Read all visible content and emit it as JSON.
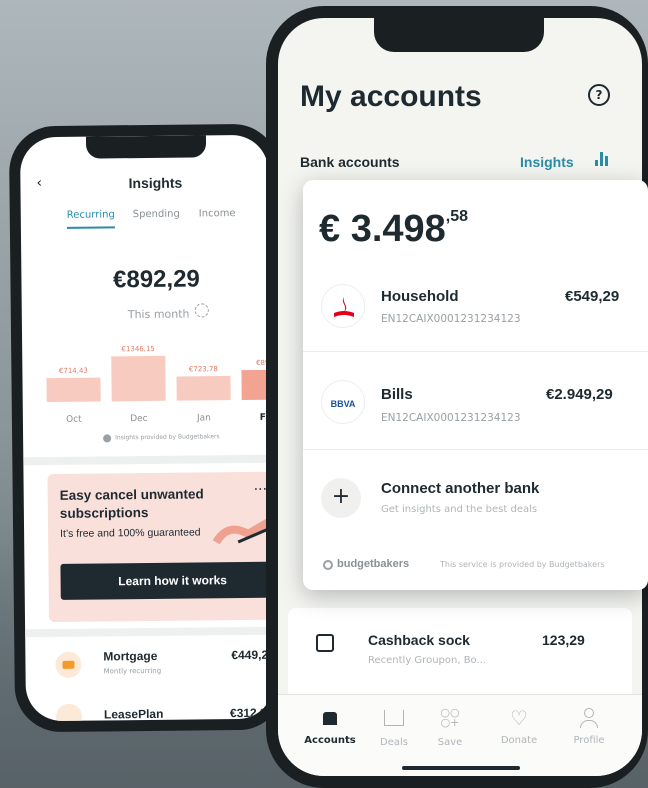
{
  "back_phone": {
    "title": "Insights",
    "tabs": [
      "Recurring",
      "Spending",
      "Income"
    ],
    "amount": "€892,29",
    "period": "This month",
    "bars": [
      {
        "value_label": "€714,43",
        "month": "Oct",
        "value": 714.43
      },
      {
        "value_label": "€1346,15",
        "month": "Dec",
        "value": 1346.15
      },
      {
        "value_label": "€723,78",
        "month": "Jan",
        "value": 723.78
      },
      {
        "value_label": "€892,2",
        "month": "Feb",
        "value": 892.29
      }
    ],
    "attribution": "Insights provided by Budgetbakers",
    "promo": {
      "title_line1": "Easy cancel unwanted",
      "title_line2": "subscriptions",
      "subtitle": "It’s free and 100% guaranteed",
      "more": "···",
      "button": "Learn how it works"
    },
    "items": [
      {
        "name": "Mortgage",
        "sub": "Montly recurring",
        "amount": "€449,29"
      },
      {
        "name": "LeasePlan",
        "sub": "",
        "amount": "€312,95"
      }
    ]
  },
  "front_phone": {
    "title": "My accounts",
    "section": "Bank accounts",
    "insights_link": "Insights",
    "balance_main": "€ 3.498",
    "balance_cents": ",58",
    "accounts": [
      {
        "name": "Household",
        "iban": "EN12CAIX0001231234123",
        "amount": "€549,29"
      },
      {
        "name": "Bills",
        "iban": "EN12CAIX0001231234123",
        "amount": "€2.949,29",
        "logo": "BBVA"
      }
    ],
    "connect": {
      "title": "Connect another bank",
      "subtitle": "Get insights and the best deals"
    },
    "footer": {
      "brand": "budgetbakers",
      "note": "This service is provided by Budgetbakers"
    },
    "cashback": {
      "title": "Cashback sock",
      "subtitle": "Recently Groupon, Bo...",
      "amount": "123,29"
    },
    "nav": [
      "Accounts",
      "Deals",
      "Save",
      "Donate",
      "Profile"
    ]
  },
  "colors": {
    "accent": "#2a8ca6",
    "dark": "#1e2a30",
    "promo_bg": "#f9e0da",
    "bar": "#f8cbc0",
    "bar_active": "#f2a391",
    "santander": "#e2001a",
    "bbva": "#1a4f9c"
  }
}
